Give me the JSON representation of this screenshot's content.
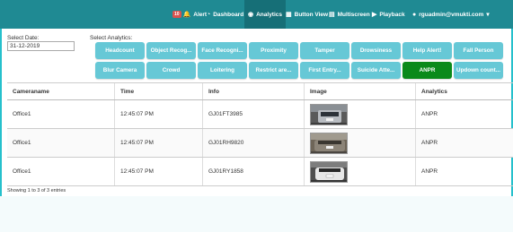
{
  "nav": {
    "alert_badge": "10",
    "alert": "Alert",
    "dashboard": "Dashboard",
    "analytics": "Analytics",
    "button_view": "Button View",
    "multiscreen": "Multiscreen",
    "playback": "Playback",
    "user": "rguadmin@vmukti.com",
    "user_caret": "▾"
  },
  "filters": {
    "date_label": "Select Date:",
    "date_value": "31-12-2019",
    "analytics_label": "Select Analytics:"
  },
  "analytics_buttons": [
    {
      "label": "Headcount"
    },
    {
      "label": "Object Recog..."
    },
    {
      "label": "Face Recogni..."
    },
    {
      "label": "Proximity"
    },
    {
      "label": "Tamper"
    },
    {
      "label": "Drowsiness"
    },
    {
      "label": "Help Alert!"
    },
    {
      "label": "Fall Person"
    },
    {
      "label": "Blur Camera"
    },
    {
      "label": "Crowd"
    },
    {
      "label": "Loitering"
    },
    {
      "label": "Restrict are..."
    },
    {
      "label": "First Entry..."
    },
    {
      "label": "Suicide Atte..."
    },
    {
      "label": "ANPR",
      "active": true
    },
    {
      "label": "Updown count..."
    }
  ],
  "table": {
    "columns": [
      "Cameraname",
      "Time",
      "Info",
      "Image",
      "Analytics"
    ],
    "rows": [
      {
        "camera": "Office1",
        "time": "12:45:07 PM",
        "info": "GJ01FT3985",
        "analytics": "ANPR"
      },
      {
        "camera": "Office1",
        "time": "12:45:07 PM",
        "info": "GJ01RH9820",
        "analytics": "ANPR"
      },
      {
        "camera": "Office1",
        "time": "12:45:07 PM",
        "info": "GJ01RY1858",
        "analytics": "ANPR"
      }
    ]
  },
  "footer": {
    "entries_info": "Showing 1 to 3 of 3 entries"
  },
  "colors": {
    "nav_bg": "#1f8a93",
    "button_bg": "#66c8d6",
    "button_active": "#0a8a1a"
  }
}
